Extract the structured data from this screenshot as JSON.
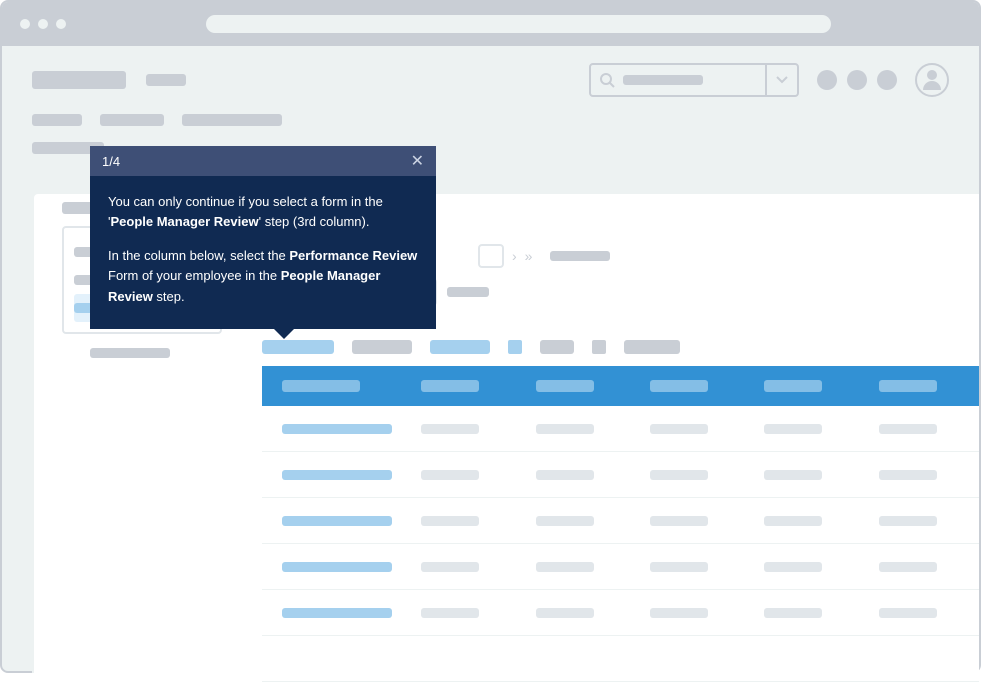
{
  "tooltip": {
    "step": "1/4",
    "p1_pre": "You can only continue if you select a form in the '",
    "p1_bold": "People Manager Review",
    "p1_post": "' step (3rd column).",
    "p2_pre": "In the column below, select the ",
    "p2_b1": "Performance Review",
    "p2_mid": " Form of your employee in the ",
    "p2_b2": "People Manager Review",
    "p2_post": " step."
  }
}
